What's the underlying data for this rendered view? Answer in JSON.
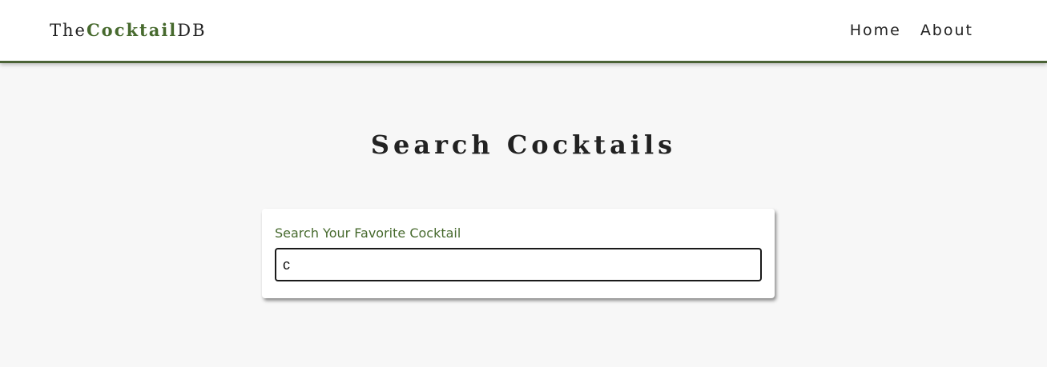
{
  "navbar": {
    "logo": {
      "prefix": "The",
      "accent": "Cocktail",
      "suffix": "DB"
    },
    "links": [
      {
        "label": "Home"
      },
      {
        "label": "About"
      }
    ]
  },
  "main": {
    "title": "Search Cocktails"
  },
  "search": {
    "label": "Search Your Favorite Cocktail",
    "value": "c"
  },
  "colors": {
    "accent": "#476a2e",
    "navbar_border": "#4b6336",
    "background": "#f7f7f7",
    "text": "#222222"
  }
}
